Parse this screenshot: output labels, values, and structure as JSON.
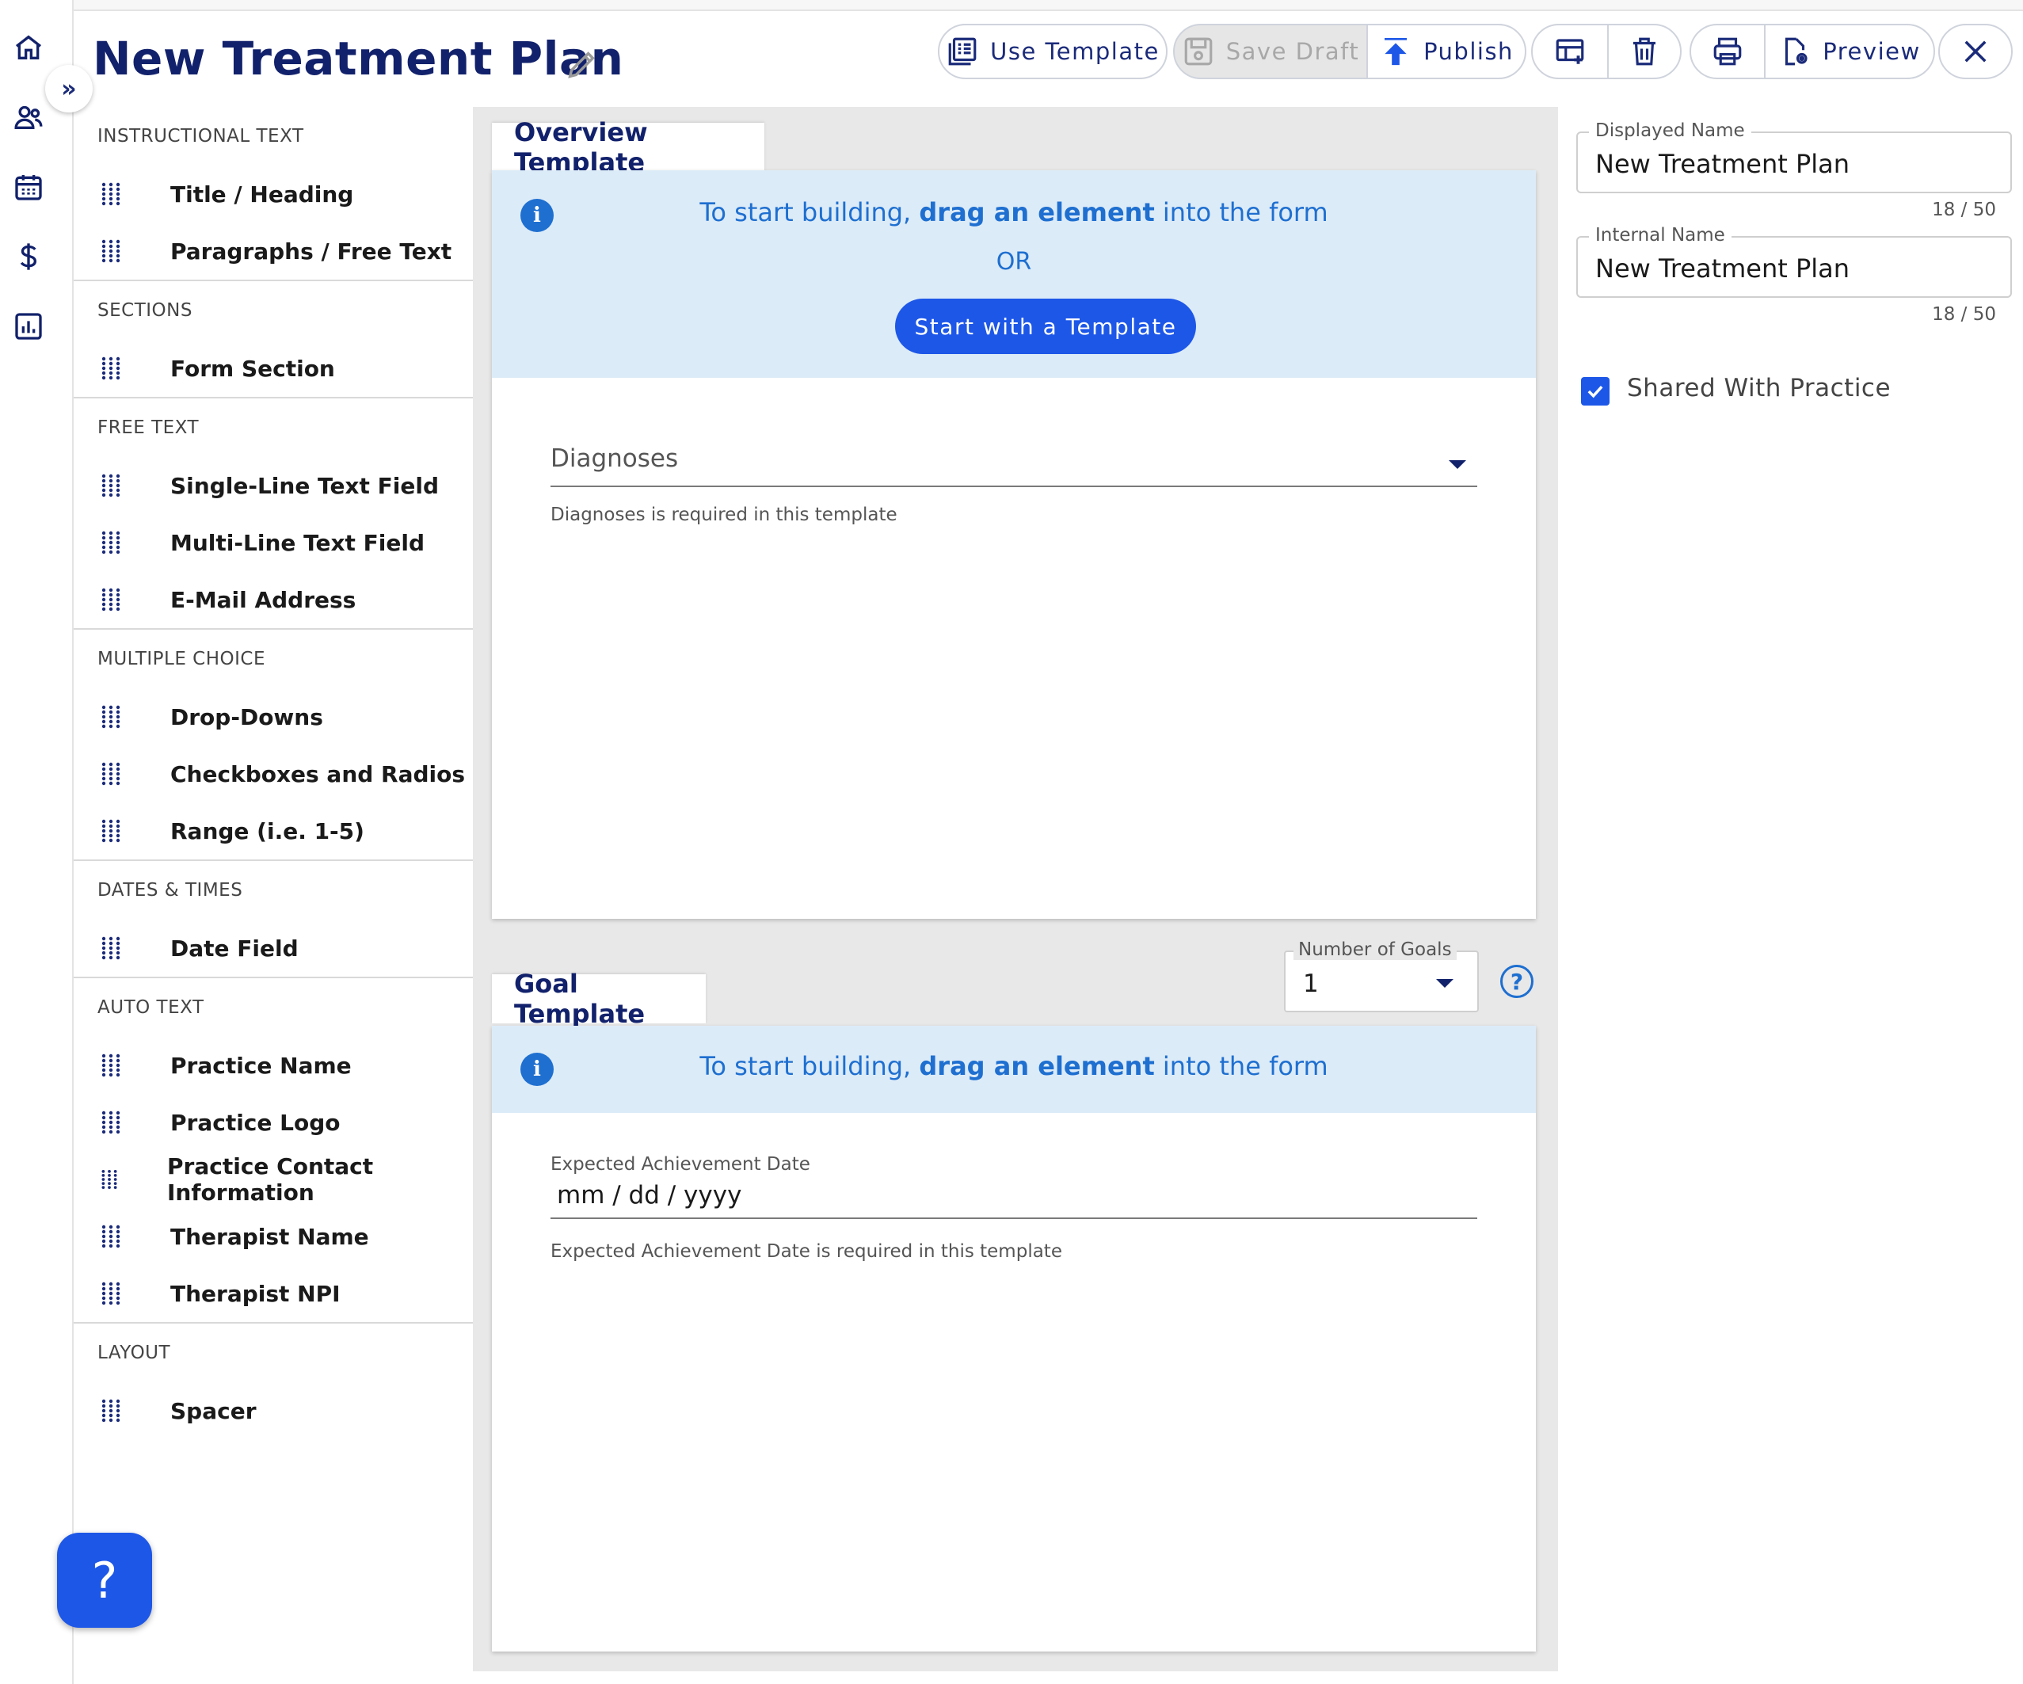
{
  "header": {
    "title": "New Treatment Plan"
  },
  "toolbar": {
    "use_template": "Use Template",
    "save_draft": "Save Draft",
    "publish": "Publish",
    "preview": "Preview"
  },
  "palette": {
    "sections": [
      {
        "header": "INSTRUCTIONAL TEXT",
        "items": [
          "Title / Heading",
          "Paragraphs / Free Text"
        ]
      },
      {
        "header": "SECTIONS",
        "items": [
          "Form Section"
        ]
      },
      {
        "header": "FREE TEXT",
        "items": [
          "Single-Line Text Field",
          "Multi-Line Text Field",
          "E-Mail Address"
        ]
      },
      {
        "header": "MULTIPLE CHOICE",
        "items": [
          "Drop-Downs",
          "Checkboxes and Radios",
          "Range (i.e. 1-5)"
        ]
      },
      {
        "header": "DATES & TIMES",
        "items": [
          "Date Field"
        ]
      },
      {
        "header": "AUTO TEXT",
        "items": [
          "Practice Name",
          "Practice Logo",
          "Practice Contact Information",
          "Therapist Name",
          "Therapist NPI"
        ]
      },
      {
        "header": "LAYOUT",
        "items": [
          "Spacer"
        ]
      }
    ]
  },
  "overview": {
    "tab": "Overview Template",
    "info_prefix": "To start building, ",
    "info_bold": "drag an element",
    "info_suffix": " into the form",
    "or": "OR",
    "start_button": "Start with a Template",
    "diagnoses_label": "Diagnoses",
    "diagnoses_helper": "Diagnoses is required in this template"
  },
  "goal": {
    "tab": "Goal Template",
    "number_label": "Number of Goals",
    "number_value": "1",
    "info_prefix": "To start building, ",
    "info_bold": "drag an element",
    "info_suffix": " into the form",
    "date_label": "Expected Achievement Date",
    "date_placeholder": "mm / dd / yyyy",
    "date_helper": "Expected Achievement Date is required in this template"
  },
  "settings": {
    "displayed_label": "Displayed Name",
    "displayed_value": "New Treatment Plan",
    "displayed_counter": "18 / 50",
    "internal_label": "Internal Name",
    "internal_value": "New Treatment Plan",
    "internal_counter": "18 / 50",
    "shared_label": "Shared With Practice"
  },
  "colors": {
    "primary": "#1d57e8",
    "navy": "#12216b",
    "info_bg": "#dcebf8"
  }
}
